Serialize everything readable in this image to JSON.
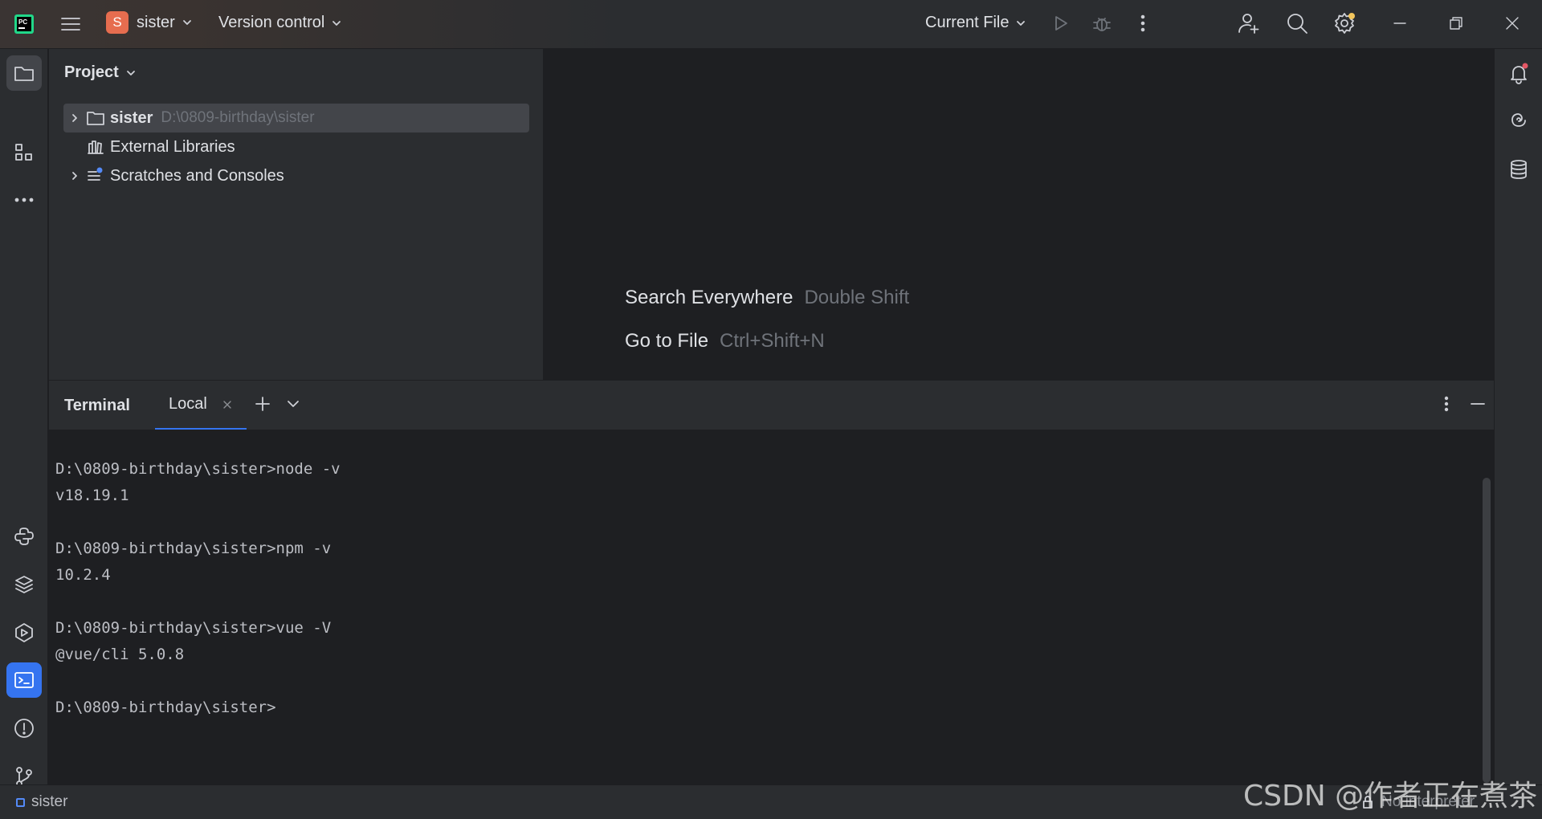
{
  "titlebar": {
    "project_badge": "S",
    "project_name": "sister",
    "vcs_label": "Version control",
    "run_config": "Current File",
    "accent": "#e66d4f"
  },
  "project_panel": {
    "title": "Project",
    "tree": [
      {
        "label": "sister",
        "path": "D:\\0809-birthday\\sister",
        "icon": "folder-icon",
        "expandable": true,
        "selected": true
      },
      {
        "label": "External Libraries",
        "icon": "library-icon",
        "expandable": false
      },
      {
        "label": "Scratches and Consoles",
        "icon": "scratches-icon",
        "expandable": true
      }
    ]
  },
  "editor": {
    "hints": [
      {
        "action": "Search Everywhere",
        "shortcut": "Double Shift"
      },
      {
        "action": "Go to File",
        "shortcut": "Ctrl+Shift+N"
      }
    ]
  },
  "terminal": {
    "title": "Terminal",
    "tab": "Local",
    "lines": [
      "D:\\0809-birthday\\sister>node -v",
      "v18.19.1",
      "",
      "D:\\0809-birthday\\sister>npm -v",
      "10.2.4",
      "",
      "D:\\0809-birthday\\sister>vue -V",
      "@vue/cli 5.0.8",
      "",
      "D:\\0809-birthday\\sister>"
    ]
  },
  "statusbar": {
    "project": "sister",
    "interpreter": "No interpreter"
  },
  "watermark": "CSDN @作者正在煮茶",
  "colors": {
    "selection": "#43454a",
    "active_tab_underline": "#3574f0",
    "notification_dot": "#e55765",
    "settings_dot": "#f2c55c"
  }
}
